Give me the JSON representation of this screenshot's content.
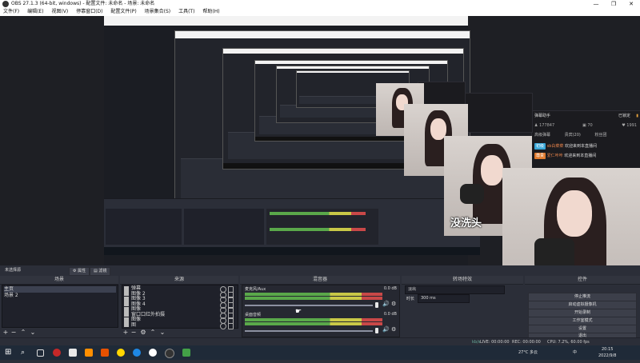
{
  "window": {
    "title": "OBS 27.1.3 (64-bit, windows) - 配置文件: 未命名 - 场景: 未命名",
    "controls": [
      "—",
      "❐",
      "✕"
    ]
  },
  "menu": [
    "文件(F)",
    "编辑(E)",
    "视图(V)",
    "停靠窗口(D)",
    "配置文件(P)",
    "场景集合(S)",
    "工具(T)",
    "帮助(H)"
  ],
  "chat_large": {
    "header_left": "弹幕助手",
    "header_right": "已锁定",
    "stats": [
      "177847",
      "70",
      "1991"
    ],
    "tabs": [
      "高级弹幕",
      "贵宾(20)",
      "粉丝团"
    ],
    "rows": [
      {
        "badge": "初级",
        "badge_color": "#3aa7d8",
        "user": "sb白菜菜",
        "msg": "欢迎来到本直播间"
      },
      {
        "badge": "尊贵",
        "badge_color": "#e07b2f",
        "user": "爱仁咔咔",
        "msg": "欢迎来到本直播间"
      }
    ]
  },
  "photo_caption": "没洗头",
  "docks": {
    "scenes": {
      "title": "场景",
      "items": [
        "主页",
        "场景 2"
      ],
      "selected": 0
    },
    "sources": {
      "title": "来源",
      "items": [
        "弹幕",
        "图像 2",
        "图像 3",
        "图像 4",
        "图像",
        "窗口口红外拍摄",
        "图像",
        "图"
      ]
    },
    "mixer": {
      "title": "混音器",
      "channels": [
        {
          "name": "麦克风/Aux",
          "db": "0.0 dB"
        },
        {
          "name": "桌面音频",
          "db": "0.0 dB"
        }
      ]
    },
    "transitions": {
      "title": "转场特效",
      "type": "淡出",
      "duration_label": "时长",
      "duration_value": "300 ms"
    },
    "controls": {
      "title": "控件",
      "buttons": [
        "停止推流",
        "启动虚拟摄像机",
        "开始录制",
        "工作室模式",
        "设置",
        "退出"
      ]
    }
  },
  "scene_tabs": [
    "未选择源",
    "属性",
    "滤镜"
  ],
  "status": {
    "live": "LIVE: 00:00:00",
    "rec": "REC: 00:00:00",
    "cpu": "CPU: 7.2%, 60.00 fps",
    "kbps": "kb/s"
  },
  "taskbar": {
    "weather": "27°C 多云",
    "time": "20:15",
    "date": "2022/9/8",
    "lang": "中"
  },
  "colors": {
    "obs_bg": "#2b2e38",
    "list_bg": "#1f212a",
    "taskbar_bg": "#1f2a38",
    "meter_green": "#5aa84a",
    "meter_yellow": "#c9c847",
    "meter_red": "#c94848"
  }
}
